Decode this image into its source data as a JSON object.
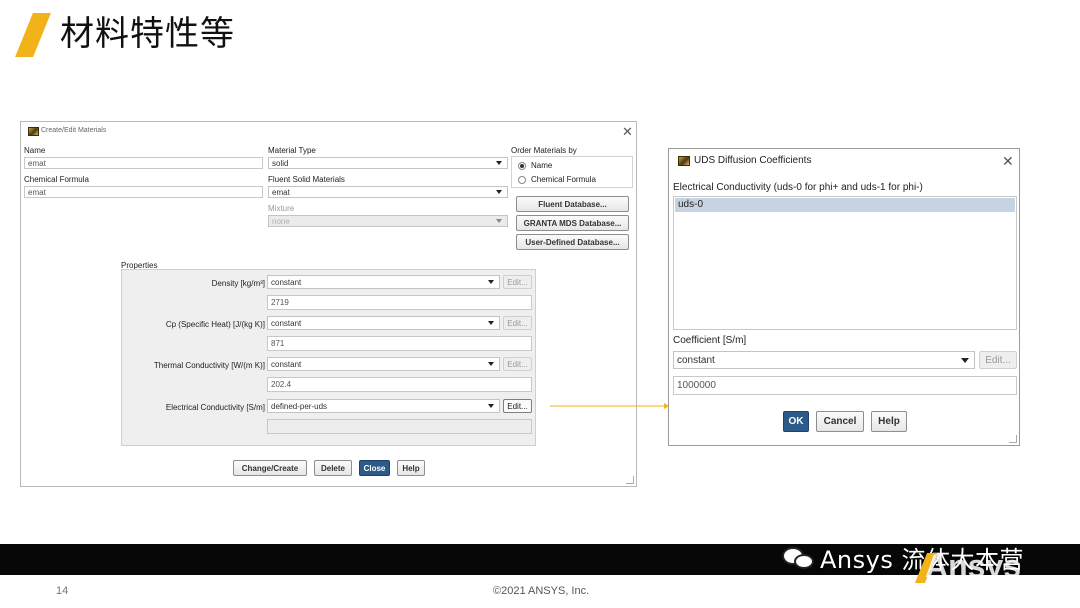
{
  "slide": {
    "title": "材料特性等",
    "page_number": "14",
    "copyright": "©2021 ANSYS, Inc.",
    "watermark": "Ansys 流体大本营",
    "logo": "Ansys"
  },
  "colors": {
    "accent": "#f2b21a",
    "primary_button": "#2c5b8a",
    "connector_line": "#f2b21a",
    "footer_band": "#070707"
  },
  "materials_dialog": {
    "title": "Create/Edit Materials",
    "close_icon": "close-icon",
    "name_label": "Name",
    "name_value": "emat",
    "formula_label": "Chemical Formula",
    "formula_value": "emat",
    "material_type_label": "Material Type",
    "material_type_value": "solid",
    "fluent_solid_label": "Fluent Solid Materials",
    "fluent_solid_value": "emat",
    "mixture_label": "Mixture",
    "mixture_value": "none",
    "order_label": "Order Materials by",
    "order_options": [
      "Name",
      "Chemical Formula"
    ],
    "order_selected": "Name",
    "db_buttons": [
      "Fluent Database...",
      "GRANTA MDS Database...",
      "User-Defined Database..."
    ],
    "properties_label": "Properties",
    "properties": [
      {
        "label": "Density [kg/m³]",
        "method": "constant",
        "value": "2719",
        "edit": "Edit..."
      },
      {
        "label": "Cp (Specific Heat) [J/(kg K)]",
        "method": "constant",
        "value": "871",
        "edit": "Edit..."
      },
      {
        "label": "Thermal Conductivity [W/(m K)]",
        "method": "constant",
        "value": "202.4",
        "edit": "Edit..."
      },
      {
        "label": "Electrical Conductivity [S/m]",
        "method": "defined-per-uds",
        "value": "",
        "edit": "Edit..."
      }
    ],
    "footer_buttons": [
      "Change/Create",
      "Delete",
      "Close",
      "Help"
    ]
  },
  "uds_dialog": {
    "title": "UDS Diffusion Coefficients",
    "list_label": "Electrical Conductivity (uds-0 for phi+ and uds-1 for phi-)",
    "list_items": [
      "uds-0"
    ],
    "coefficient_label": "Coefficient [S/m]",
    "coefficient_method": "constant",
    "coefficient_edit": "Edit...",
    "coefficient_value": "1000000",
    "buttons": [
      "OK",
      "Cancel",
      "Help"
    ]
  }
}
